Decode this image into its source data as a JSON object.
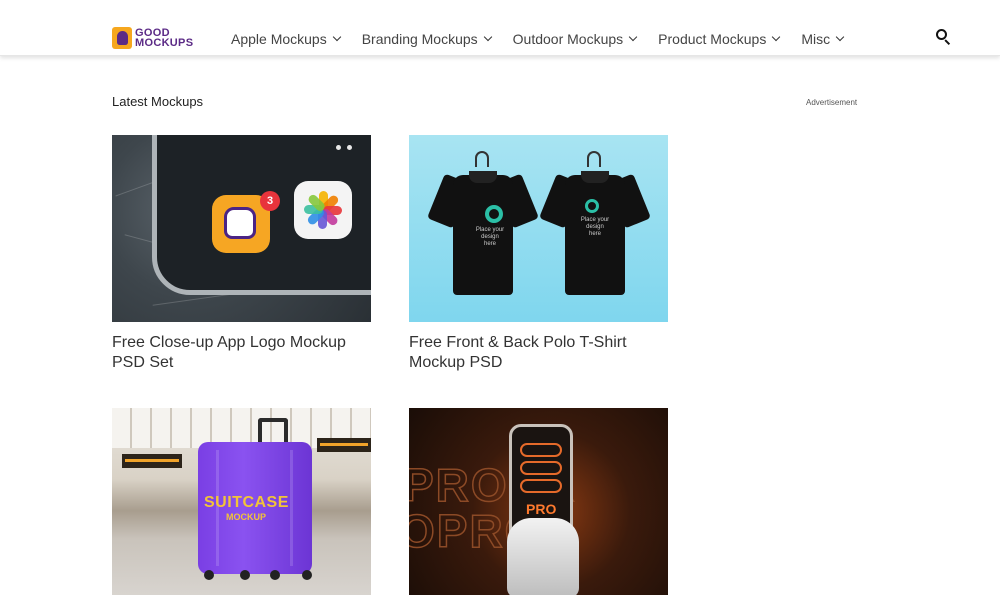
{
  "header": {
    "logo": {
      "line1": "GOOD",
      "line2": "MOCKUPS"
    },
    "nav": [
      {
        "label": "Apple Mockups"
      },
      {
        "label": "Branding Mockups"
      },
      {
        "label": "Outdoor Mockups"
      },
      {
        "label": "Product Mockups"
      },
      {
        "label": "Misc"
      }
    ],
    "search_icon": "search-icon"
  },
  "main": {
    "section_title": "Latest Mockups",
    "ad_label": "Advertisement",
    "cards": [
      {
        "title": "Free Close-up App Logo Mockup PSD Set",
        "badge": "3"
      },
      {
        "title": "Free Front & Back Polo T-Shirt Mockup PSD",
        "shirt_text": "Place your design here"
      },
      {
        "title": "",
        "case_line1": "SUITCASE",
        "case_line2": "MOCKUP"
      },
      {
        "title": "",
        "phone_text": "PRO"
      }
    ]
  },
  "colors": {
    "brand_purple": "#5b2a86",
    "brand_orange": "#f6a71e",
    "suitcase_purple": "#7a3fe4",
    "accent_teal": "#2bbfa6"
  }
}
